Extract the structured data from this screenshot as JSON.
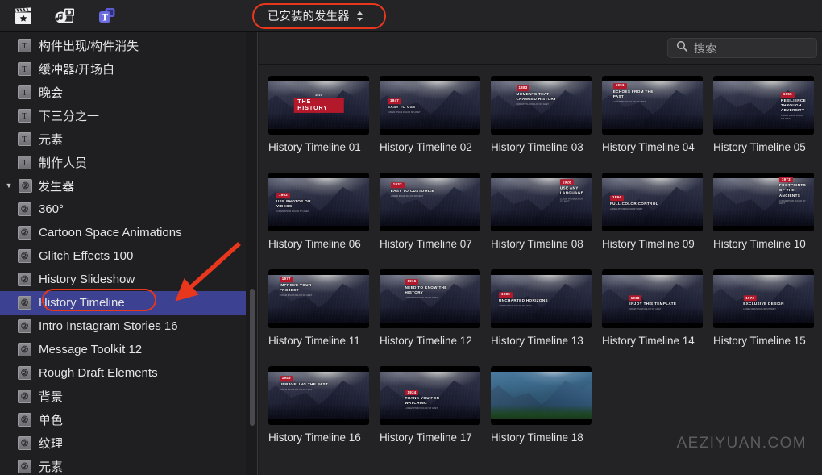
{
  "toolbar": {
    "icons": [
      {
        "name": "effects-clapperboard-icon",
        "label": "效果"
      },
      {
        "name": "media-photos-audio-icon",
        "label": "媒体"
      },
      {
        "name": "titles-generators-icon",
        "label": "字幕与发生器"
      }
    ],
    "library_select": {
      "value": "已安装的发生器",
      "chevron": "⌃⌄"
    }
  },
  "search": {
    "placeholder": "搜索",
    "value": "",
    "icon": "search-icon"
  },
  "sidebar": {
    "items": [
      {
        "label": "构件出现/构件消失",
        "badge": "T",
        "type": "title",
        "indent": 1,
        "selected": false
      },
      {
        "label": "缓冲器/开场白",
        "badge": "T",
        "type": "title",
        "indent": 1,
        "selected": false
      },
      {
        "label": "晚会",
        "badge": "T",
        "type": "title",
        "indent": 1,
        "selected": false
      },
      {
        "label": "下三分之一",
        "badge": "T",
        "type": "title",
        "indent": 1,
        "selected": false
      },
      {
        "label": "元素",
        "badge": "T",
        "type": "title",
        "indent": 1,
        "selected": false
      },
      {
        "label": "制作人员",
        "badge": "T",
        "type": "title",
        "indent": 1,
        "selected": false
      },
      {
        "label": "发生器",
        "badge": "②",
        "type": "group",
        "indent": 0,
        "selected": false,
        "disclosure": "▼"
      },
      {
        "label": "360°",
        "badge": "②",
        "type": "generator",
        "indent": 1,
        "selected": false
      },
      {
        "label": "Cartoon Space Animations",
        "badge": "②",
        "type": "generator",
        "indent": 1,
        "selected": false
      },
      {
        "label": "Glitch Effects 100",
        "badge": "②",
        "type": "generator",
        "indent": 1,
        "selected": false
      },
      {
        "label": "History Slideshow",
        "badge": "②",
        "type": "generator",
        "indent": 1,
        "selected": false
      },
      {
        "label": "History Timeline",
        "badge": "②",
        "type": "generator",
        "indent": 1,
        "selected": true
      },
      {
        "label": "Intro Instagram Stories 16",
        "badge": "②",
        "type": "generator",
        "indent": 1,
        "selected": false
      },
      {
        "label": "Message Toolkit 12",
        "badge": "②",
        "type": "generator",
        "indent": 1,
        "selected": false
      },
      {
        "label": "Rough Draft Elements",
        "badge": "②",
        "type": "generator",
        "indent": 1,
        "selected": false
      },
      {
        "label": "背景",
        "badge": "②",
        "type": "generator",
        "indent": 1,
        "selected": false
      },
      {
        "label": "单色",
        "badge": "②",
        "type": "generator",
        "indent": 1,
        "selected": false
      },
      {
        "label": "纹理",
        "badge": "②",
        "type": "generator",
        "indent": 1,
        "selected": false
      },
      {
        "label": "元素",
        "badge": "②",
        "type": "generator",
        "indent": 1,
        "selected": false
      }
    ]
  },
  "browser": {
    "watermark": "AEZIYUAN.COM",
    "items": [
      {
        "caption": "History Timeline 01",
        "year": "1927",
        "title": "THE HISTORY",
        "sub": "",
        "style": "logo",
        "pos": "center",
        "theme": "mono"
      },
      {
        "caption": "History Timeline 02",
        "year": "1947",
        "title": "EASY TO USE",
        "sub": "LOREM IPSUM DOLOR SIT AMET",
        "style": "plate",
        "pos": "left-mid",
        "theme": "mono"
      },
      {
        "caption": "History Timeline 03",
        "year": "1883",
        "title": "MOMENTS THAT CHANGED HISTORY",
        "sub": "LOREM IPSUM DOLOR SIT AMET",
        "style": "plate",
        "pos": "center-top",
        "theme": "mono"
      },
      {
        "caption": "History Timeline 04",
        "year": "1951",
        "title": "ECHOES FROM THE PAST",
        "sub": "LOREM IPSUM DOLOR SIT AMET",
        "style": "plate",
        "pos": "left-top",
        "theme": "mono"
      },
      {
        "caption": "History Timeline 05",
        "year": "1955",
        "title": "RESILIENCE THROUGH ADVERSITY",
        "sub": "LOREM IPSUM DOLOR SIT AMET",
        "style": "plate",
        "pos": "right-mid",
        "theme": "mono"
      },
      {
        "caption": "History Timeline 06",
        "year": "1962",
        "title": "USE PHOTOS OR VIDEOS",
        "sub": "LOREM IPSUM DOLOR SIT AMET",
        "style": "plate",
        "pos": "left-mid",
        "theme": "mono"
      },
      {
        "caption": "History Timeline 07",
        "year": "1932",
        "title": "EASY TO CUSTOMIZE",
        "sub": "LOREM IPSUM DOLOR SIT AMET",
        "style": "plate",
        "pos": "left-top",
        "theme": "mono"
      },
      {
        "caption": "History Timeline 08",
        "year": "1928",
        "title": "USE ANY LANGUAGE",
        "sub": "LOREM IPSUM DOLOR SIT AMET",
        "style": "plate",
        "pos": "right-top",
        "theme": "mono"
      },
      {
        "caption": "History Timeline 09",
        "year": "1894",
        "title": "FULL COLOR CONTROL",
        "sub": "LOREM IPSUM DOLOR SIT AMET",
        "style": "plate",
        "pos": "left-mid",
        "theme": "mono"
      },
      {
        "caption": "History Timeline 10",
        "year": "1973",
        "title": "FOOTPRINTS OF THE ANCIENTS",
        "sub": "LOREM IPSUM DOLOR SIT AMET",
        "style": "plate",
        "pos": "right-top",
        "theme": "mono"
      },
      {
        "caption": "History Timeline 11",
        "year": "1977",
        "title": "IMPROVE YOUR PROJECT",
        "sub": "LOREM IPSUM DOLOR SIT AMET",
        "style": "plate",
        "pos": "left-top",
        "theme": "mono"
      },
      {
        "caption": "History Timeline 12",
        "year": "1915",
        "title": "NEED TO KNOW THE HISTORY",
        "sub": "LOREM IPSUM DOLOR SIT AMET",
        "style": "plate",
        "pos": "center-top",
        "theme": "mono"
      },
      {
        "caption": "History Timeline 13",
        "year": "1985",
        "title": "UNCHARTED HORIZONS",
        "sub": "LOREM IPSUM DOLOR SIT AMET",
        "style": "plate",
        "pos": "left-mid",
        "theme": "mono"
      },
      {
        "caption": "History Timeline 14",
        "year": "1968",
        "title": "ENJOY THIS TEMPLATE",
        "sub": "LOREM IPSUM DOLOR SIT AMET",
        "style": "plate",
        "pos": "center-mid",
        "theme": "mono"
      },
      {
        "caption": "History Timeline 15",
        "year": "1972",
        "title": "EXCLUSIVE DESIGN",
        "sub": "LOREM IPSUM DOLOR SIT AMET",
        "style": "plate",
        "pos": "center-mid",
        "theme": "mono"
      },
      {
        "caption": "History Timeline 16",
        "year": "1945",
        "title": "UNRAVELING THE PAST",
        "sub": "LOREM IPSUM DOLOR SIT AMET",
        "style": "plate",
        "pos": "left-top",
        "theme": "mono"
      },
      {
        "caption": "History Timeline 17",
        "year": "1934",
        "title": "THANK YOU FOR WATCHING",
        "sub": "LOREM IPSUM DOLOR SIT AMET",
        "style": "plate",
        "pos": "center-mid",
        "theme": "mono"
      },
      {
        "caption": "History Timeline 18",
        "year": "",
        "title": "",
        "sub": "",
        "style": "none",
        "pos": "center-mid",
        "theme": "green"
      }
    ]
  },
  "annotations": {
    "accent_color": "#e8371c",
    "selection_color": "#3c4192",
    "oval_dropdown": "已安装的发生器",
    "oval_item": "History Timeline",
    "arrow": "points-to-history-timeline"
  }
}
